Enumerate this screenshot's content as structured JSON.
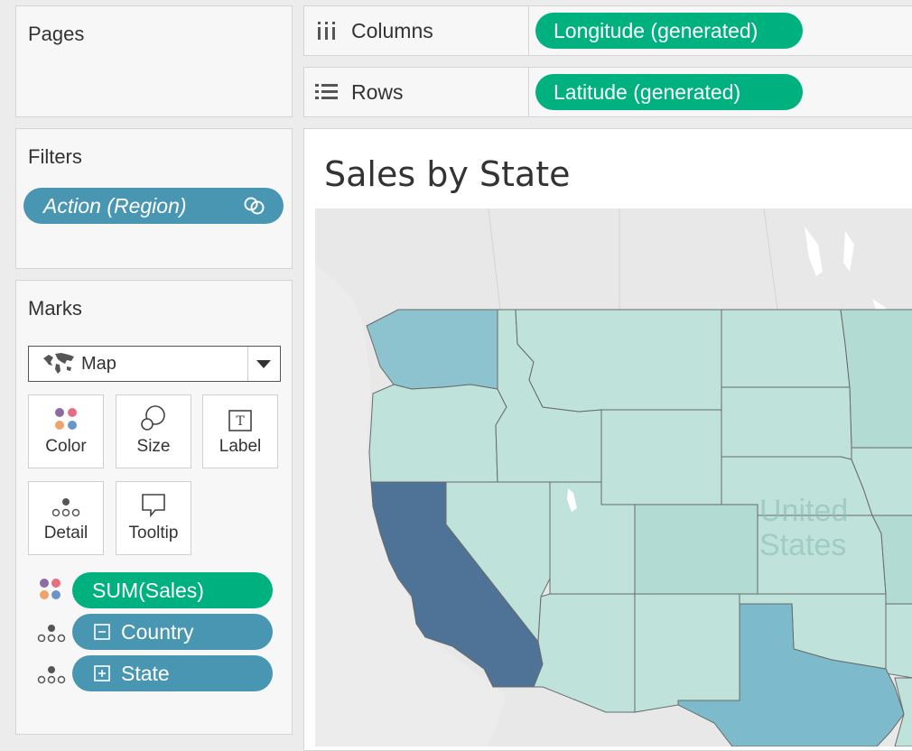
{
  "pages": {
    "title": "Pages"
  },
  "filters": {
    "title": "Filters",
    "pill": "Action (Region)"
  },
  "marks": {
    "title": "Marks",
    "mark_type": "Map",
    "cards": {
      "color": "Color",
      "size": "Size",
      "label": "Label",
      "detail": "Detail",
      "tooltip": "Tooltip"
    },
    "fields": {
      "sales": "SUM(Sales)",
      "country": "Country",
      "state": "State"
    }
  },
  "shelves": {
    "columns_label": "Columns",
    "columns_pill": "Longitude (generated)",
    "rows_label": "Rows",
    "rows_pill": "Latitude (generated)"
  },
  "view": {
    "title": "Sales by State",
    "map_label_1": "United",
    "map_label_2": "States"
  },
  "colors": {
    "green_pill": "#00b180",
    "blue_pill": "#4996b2",
    "california": "#4e7396",
    "washington": "#8dc3cf",
    "texas": "#7dbacb",
    "light_state": "#bfe2da"
  }
}
